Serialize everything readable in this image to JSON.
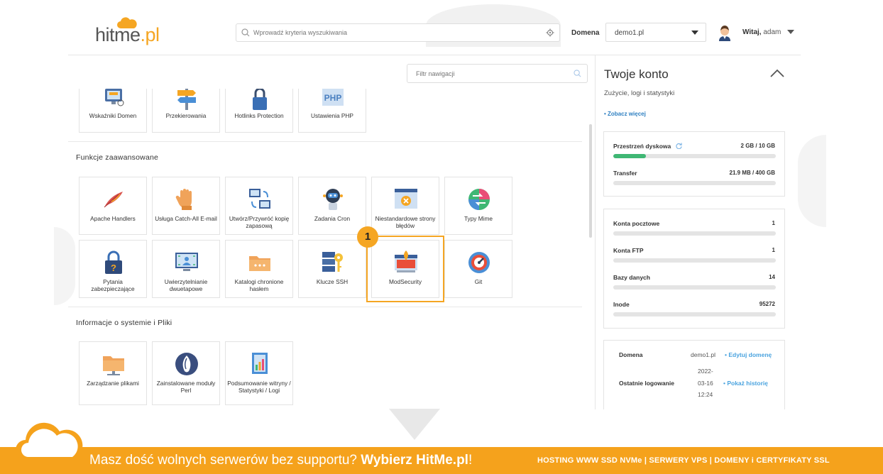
{
  "brand": {
    "logo_text": "hitme",
    "logo_suffix": ".pl",
    "accent": "#f5a623"
  },
  "header": {
    "search_placeholder": "Wprowadź kryteria wyszukiwania",
    "domain_label": "Domena",
    "domain_selected": "demo1.pl",
    "greeting_bold": "Witaj,",
    "greeting_user": "adam"
  },
  "nav": {
    "filter_placeholder": "Filtr nawigacji",
    "top_tiles": [
      {
        "label": "Wskaźniki Domen",
        "icon": "domain-pointers-icon"
      },
      {
        "label": "Przekierowania",
        "icon": "redirect-signpost-icon"
      },
      {
        "label": "Hotlinks Protection",
        "icon": "lock-icon"
      },
      {
        "label": "Ustawienia PHP",
        "icon": "php-icon"
      }
    ],
    "sections": [
      {
        "title": "Funkcje zaawansowane",
        "tiles": [
          {
            "label": "Apache Handlers",
            "icon": "feather-icon"
          },
          {
            "label": "Usługa Catch-All E-mail",
            "icon": "hand-icon"
          },
          {
            "label": "Utwórz/Przywróć kopię zapasową",
            "icon": "backup-icon"
          },
          {
            "label": "Zadania Cron",
            "icon": "robot-icon"
          },
          {
            "label": "Niestandardowe strony błędów",
            "icon": "error-page-icon"
          },
          {
            "label": "Typy Mime",
            "icon": "mime-types-icon"
          },
          {
            "label": "Pytania zabezpieczające",
            "icon": "padlock-question-icon"
          },
          {
            "label": "Uwierzytelnianie dwuetapowe",
            "icon": "two-factor-icon"
          },
          {
            "label": "Katalogi chronione hasłem",
            "icon": "protected-folder-icon"
          },
          {
            "label": "Klucze SSH",
            "icon": "ssh-key-icon"
          },
          {
            "label": "ModSecurity",
            "icon": "modsecurity-icon"
          },
          {
            "label": "Git",
            "icon": "git-icon"
          }
        ]
      },
      {
        "title": "Informacje o systemie i Pliki",
        "tiles": [
          {
            "label": "Zarządzanie plikami",
            "icon": "file-manager-icon"
          },
          {
            "label": "Zainstalowane moduły Perl",
            "icon": "perl-icon"
          },
          {
            "label": "Podsumowanie witryny / Statystyki / Logi",
            "icon": "stats-icon"
          }
        ]
      }
    ],
    "callout_number": "1"
  },
  "account": {
    "title": "Twoje konto",
    "subtitle": "Zużycie, logi i statystyki",
    "more_link": "• Zobacz więcej",
    "usage": [
      {
        "label": "Przestrzeń dyskowa",
        "value": "2 GB / 10 GB",
        "fraction": 0.2
      },
      {
        "label": "Transfer",
        "value": "21.9 MB / 400 GB",
        "fraction": 0.0
      }
    ],
    "counts": [
      {
        "label": "Konta pocztowe",
        "value": "1"
      },
      {
        "label": "Konta FTP",
        "value": "1"
      },
      {
        "label": "Bazy danych",
        "value": "14"
      },
      {
        "label": "Inode",
        "value": "95272"
      }
    ],
    "domain_row": {
      "label": "Domena",
      "value": "demo1.pl",
      "link": "• Edytuj domenę"
    },
    "login_row": {
      "label": "Ostatnie logowanie",
      "value_lines": [
        "2022-",
        "03-16",
        "12:24"
      ],
      "link": "• Pokaż historię"
    }
  },
  "footer": {
    "msg_plain": "Masz dość wolnych serwerów bez supportu? ",
    "msg_bold": "Wybierz HitMe.pl",
    "msg_end": "!",
    "right": "HOSTING WWW SSD NVMe | SERWERY VPS | DOMENY i CERTYFIKATY SSL",
    "bg_color": "#f5a21c"
  }
}
